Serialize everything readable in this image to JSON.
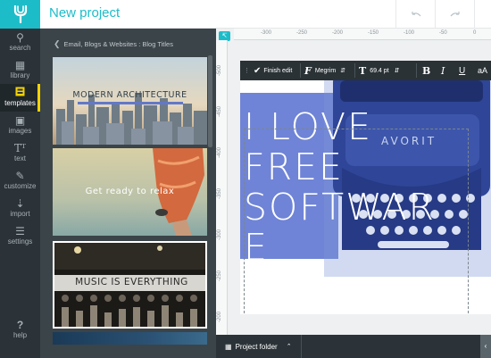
{
  "header": {
    "title": "New project",
    "undo_icon": "undo-icon",
    "redo_icon": "redo-icon"
  },
  "sidebar": {
    "items": [
      {
        "label": "search",
        "icon": "search-icon"
      },
      {
        "label": "library",
        "icon": "library-icon"
      },
      {
        "label": "templates",
        "icon": "templates-icon",
        "active": true
      },
      {
        "label": "images",
        "icon": "camera-icon"
      },
      {
        "label": "text",
        "icon": "text-icon"
      },
      {
        "label": "customize",
        "icon": "brush-icon"
      },
      {
        "label": "import",
        "icon": "import-icon"
      },
      {
        "label": "settings",
        "icon": "sliders-icon"
      }
    ],
    "help": {
      "label": "help",
      "icon": "help-icon"
    }
  },
  "panel": {
    "breadcrumb": "Email, Blogs & Websites : Blog Titles",
    "templates": [
      {
        "title": "MODERN ARCHITECTURE"
      },
      {
        "title": "Get ready to relax"
      },
      {
        "title": "MUSIC IS EVERYTHING"
      }
    ]
  },
  "ruler": {
    "top_ticks": [
      "-300",
      "-250",
      "-200",
      "-150",
      "-100",
      "-50",
      "0"
    ],
    "left_ticks": [
      "-500",
      "-450",
      "-400",
      "-350",
      "-300",
      "-250",
      "-200"
    ]
  },
  "toolbar": {
    "finish_label": "Finish edit",
    "font_name": "Megrim",
    "font_size": "69.4 pt",
    "bold": "B",
    "italic": "I",
    "underline": "U",
    "case": "aA"
  },
  "canvas": {
    "headline_lines": [
      "I LOVE",
      "FREE",
      "SOFTWAR",
      "E"
    ],
    "typewriter_brand": "AVORIT"
  },
  "bottom": {
    "project_folder": "Project folder"
  },
  "colors": {
    "accent": "#1dbcc9",
    "active_marker": "#f5d300",
    "sidebar_bg": "#2b3338",
    "panel_bg": "#3b4449",
    "artboard_overlay": "#6f84d6"
  }
}
